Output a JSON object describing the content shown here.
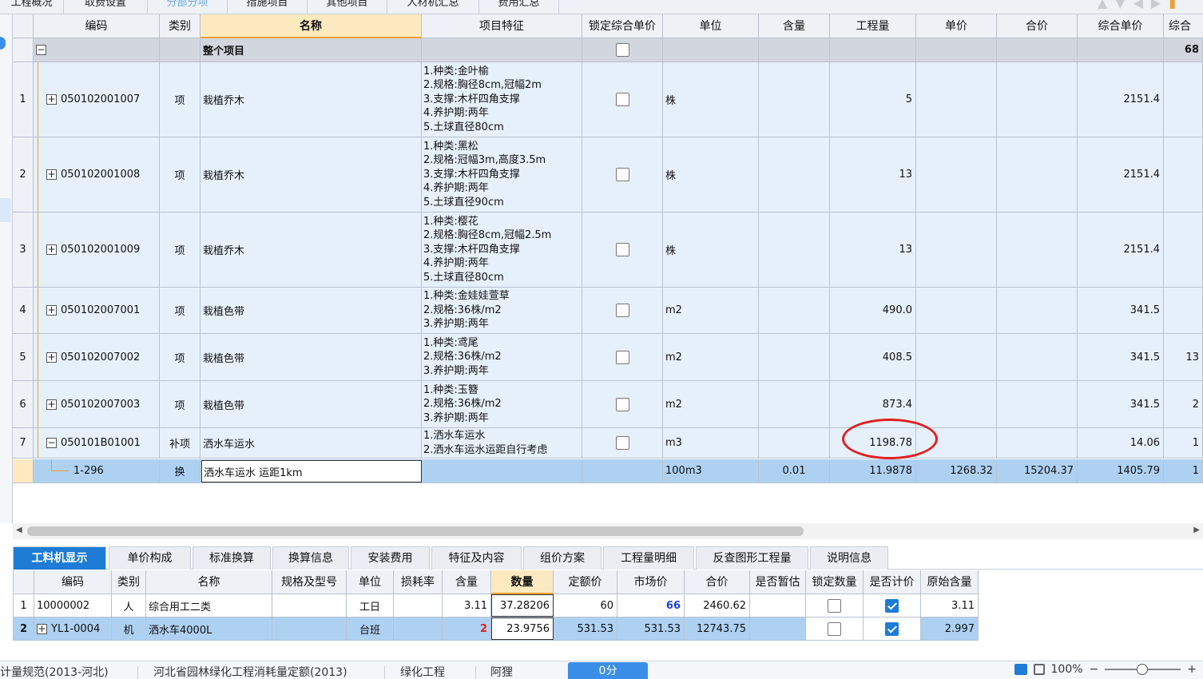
{
  "top_tabs": [
    "工程概况",
    "取费设置",
    "分部分项",
    "措施项目",
    "其他项目",
    "人材机汇总",
    "费用汇总"
  ],
  "top_active": "分部分项",
  "columns": [
    "编码",
    "类别",
    "名称",
    "项目特征",
    "锁定综合单价",
    "单位",
    "含量",
    "工程量",
    "单价",
    "合价",
    "综合单价",
    "综合"
  ],
  "summary_row": {
    "expander": "−",
    "name": "整个项目",
    "tail": "68"
  },
  "rows": [
    {
      "num": "1",
      "expander": "+",
      "code": "050102001007",
      "type": "项",
      "name": "栽植乔木",
      "features": [
        "1.种类:金叶榆",
        "2.规格:胸径8cm,冠幅2m",
        "3.支撑:木杆四角支撑",
        "4.养护期:两年",
        "5.土球直径80cm"
      ],
      "unit": "株",
      "qty": "5",
      "unit_total": "2151.4",
      "tail": ""
    },
    {
      "num": "2",
      "expander": "+",
      "code": "050102001008",
      "type": "项",
      "name": "栽植乔木",
      "features": [
        "1.种类:黑松",
        "2.规格:冠幅3m,高度3.5m",
        "3.支撑:木杆四角支撑",
        "4.养护期:两年",
        "5.土球直径90cm"
      ],
      "unit": "株",
      "qty": "13",
      "unit_total": "2151.4",
      "tail": ""
    },
    {
      "num": "3",
      "expander": "+",
      "code": "050102001009",
      "type": "项",
      "name": "栽植乔木",
      "features": [
        "1.种类:樱花",
        "2.规格:胸径8cm,冠幅2.5m",
        "3.支撑:木杆四角支撑",
        "4.养护期:两年",
        "5.土球直径80cm"
      ],
      "unit": "株",
      "qty": "13",
      "unit_total": "2151.4",
      "tail": ""
    },
    {
      "num": "4",
      "expander": "+",
      "code": "050102007001",
      "type": "项",
      "name": "栽植色带",
      "features": [
        "1.种类:金娃娃萱草",
        "2.规格:36株/m2",
        "3.养护期:两年"
      ],
      "unit": "m2",
      "qty": "490.0",
      "unit_total": "341.5",
      "tail": ""
    },
    {
      "num": "5",
      "expander": "+",
      "code": "050102007002",
      "type": "项",
      "name": "栽植色带",
      "features": [
        "1.种类:鸢尾",
        "2.规格:36株/m2",
        "3.养护期:两年"
      ],
      "unit": "m2",
      "qty": "408.5",
      "unit_total": "341.5",
      "tail": "13"
    },
    {
      "num": "6",
      "expander": "+",
      "code": "050102007003",
      "type": "项",
      "name": "栽植色带",
      "features": [
        "1.种类:玉簪",
        "2.规格:36株/m2",
        "3.养护期:两年"
      ],
      "unit": "m2",
      "qty": "873.4",
      "unit_total": "341.5",
      "tail": "2"
    },
    {
      "num": "7",
      "expander": "−",
      "code": "050101B01001",
      "type": "补项",
      "name": "洒水车运水",
      "features": [
        "1.洒水车运水",
        "2.洒水车运水运距自行考虑"
      ],
      "unit": "m3",
      "qty": "1198.78",
      "unit_total": "14.06",
      "tail": "1"
    }
  ],
  "sub_row": {
    "code": "1-296",
    "type": "换",
    "name": "洒水车运水 运距1km",
    "unit": "100m3",
    "content": "0.01",
    "qty": "11.9878",
    "price": "1268.32",
    "total": "15204.37",
    "unit_total": "1405.79",
    "tail": "1"
  },
  "bottom_tabs": [
    "工料机显示",
    "单价构成",
    "标准换算",
    "换算信息",
    "安装费用",
    "特征及内容",
    "组价方案",
    "工程量明细",
    "反查图形工程量",
    "说明信息"
  ],
  "bottom_columns": [
    "编码",
    "类别",
    "名称",
    "规格及型号",
    "单位",
    "损耗率",
    "含量",
    "数量",
    "定额价",
    "市场价",
    "合价",
    "是否暂估",
    "锁定数量",
    "是否计价",
    "原始含量"
  ],
  "bottom_rows": [
    {
      "num": "1",
      "expander": "",
      "code": "10000002",
      "type": "人",
      "name": "综合用工二类",
      "spec": "",
      "unit": "工日",
      "loss": "",
      "content": "3.11",
      "qty": "37.28206",
      "quota_price": "60",
      "market_price": "66",
      "total": "2460.62",
      "is_estimate": "",
      "lock_qty": false,
      "priced": true,
      "orig_content": "3.11"
    },
    {
      "num": "2",
      "expander": "+",
      "code": "YL1-0004",
      "type": "机",
      "name": "洒水车4000L",
      "spec": "",
      "unit": "台班",
      "loss": "",
      "content": "2",
      "qty": "23.9756",
      "quota_price": "531.53",
      "market_price": "531.53",
      "total": "12743.75",
      "is_estimate": "",
      "lock_qty": false,
      "priced": true,
      "orig_content": "2.997"
    }
  ],
  "status": {
    "items": [
      "计量规范(2013-河北)",
      "河北省园林绿化工程消耗量定额(2013)",
      "绿化工程",
      "阿狸"
    ],
    "score_button": "0分",
    "zoom": "100%"
  },
  "colors": {
    "accent": "#1e7bd6",
    "row_bg": "#e6f0fb",
    "selected": "#aed1f2",
    "highlight_header": "#fde9c0",
    "annotation": "#e02020"
  }
}
